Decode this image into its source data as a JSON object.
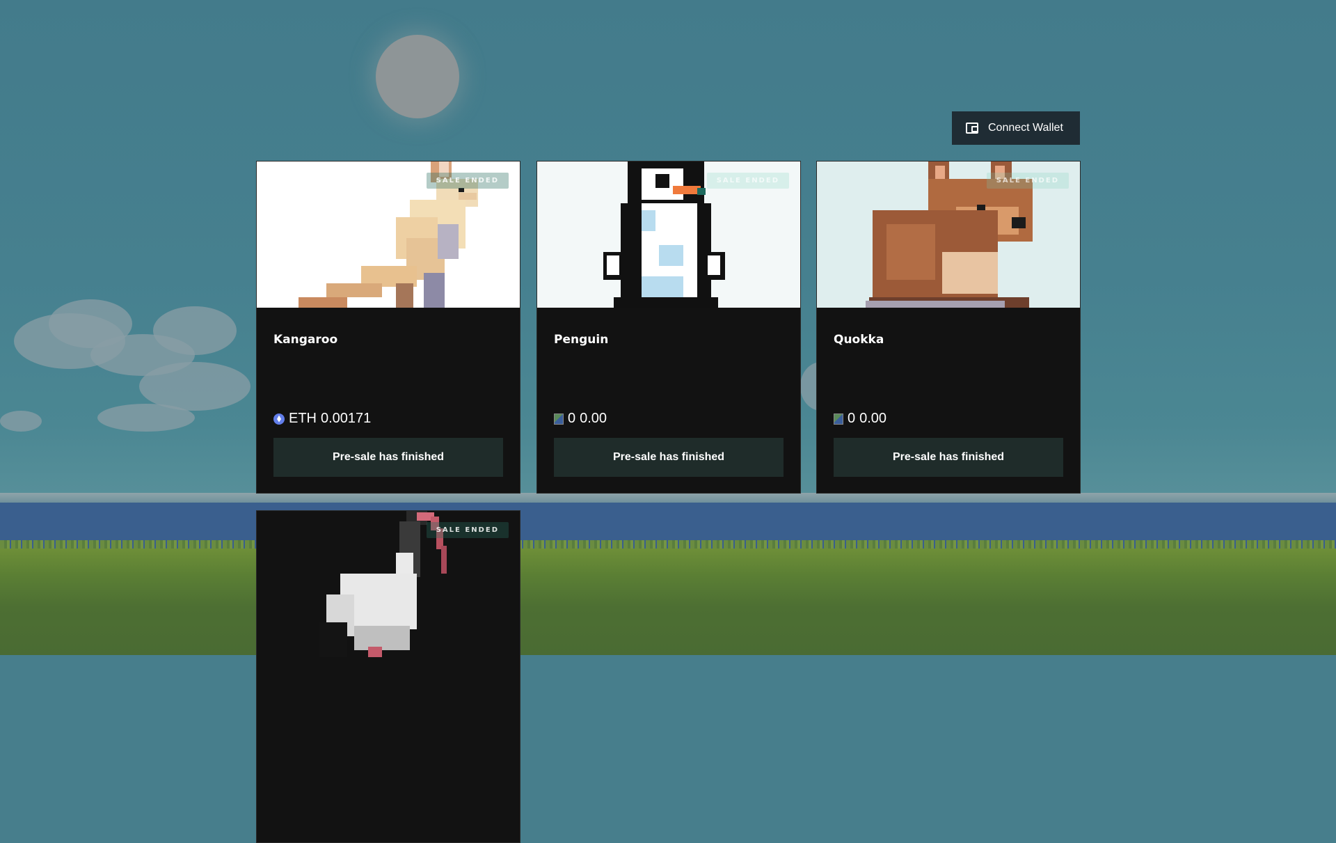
{
  "header": {
    "connect_wallet_label": "Connect Wallet"
  },
  "colors": {
    "card_background": "#121212",
    "button_background": "#1f2c2a",
    "wallet_button_background": "#1f2c34",
    "sky": "#46808f"
  },
  "cards": [
    {
      "title": "Kangaroo",
      "badge": "SALE ENDED",
      "currency": "ETH",
      "price": "0.00171",
      "price_icon": "ethereum-icon",
      "button_label": "Pre-sale has finished"
    },
    {
      "title": "Penguin",
      "badge": "SALE ENDED",
      "currency": "0",
      "price": "0.00",
      "price_icon": "broken-image-icon",
      "button_label": "Pre-sale has finished"
    },
    {
      "title": "Quokka",
      "badge": "SALE ENDED",
      "currency": "0",
      "price": "0.00",
      "price_icon": "broken-image-icon",
      "button_label": "Pre-sale has finished"
    },
    {
      "title": "",
      "badge": "SALE ENDED"
    }
  ]
}
